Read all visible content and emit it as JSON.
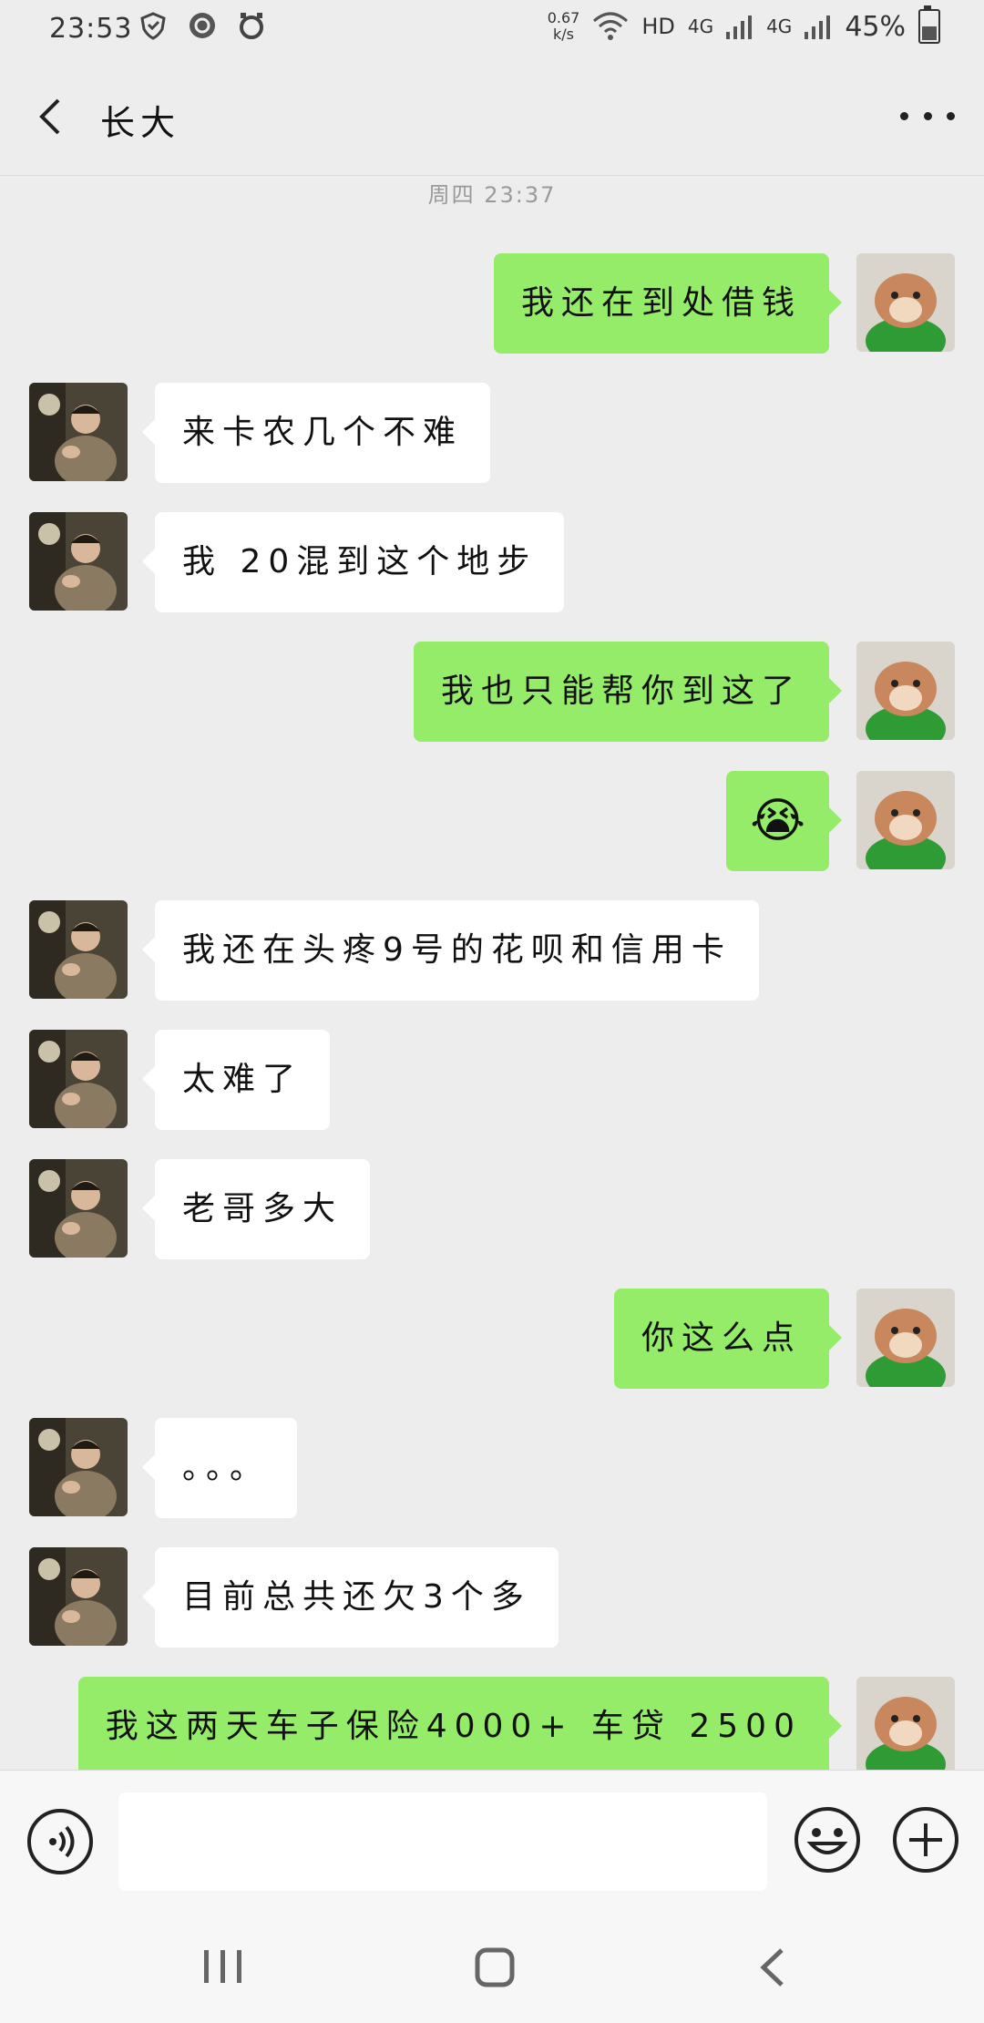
{
  "status_bar": {
    "time": "23:53",
    "speed_value": "0.67",
    "speed_unit": "k/s",
    "hd": "HD",
    "net1": "4G",
    "net2": "4G",
    "battery": "45%"
  },
  "header": {
    "title": "长大"
  },
  "chat": {
    "timestamp": "周四 23:37",
    "messages": [
      {
        "side": "out",
        "text": "我还在到处借钱"
      },
      {
        "side": "in",
        "text": "来卡农几个不难"
      },
      {
        "side": "in",
        "text": "我 20混到这个地步"
      },
      {
        "side": "out",
        "text": "我也只能帮你到这了"
      },
      {
        "side": "out",
        "text": "😭"
      },
      {
        "side": "in",
        "text": "我还在头疼9号的花呗和信用卡"
      },
      {
        "side": "in",
        "text": "太难了"
      },
      {
        "side": "in",
        "text": "老哥多大"
      },
      {
        "side": "out",
        "text": "你这么点"
      },
      {
        "side": "in",
        "text": "。。。"
      },
      {
        "side": "in",
        "text": "目前总共还欠3个多"
      },
      {
        "side": "out",
        "text": "我这两天车子保险4000+ 车贷 2500"
      }
    ]
  },
  "input": {
    "placeholder": ""
  },
  "icons": {
    "back": "back-arrow-icon",
    "more": "more-dots-icon",
    "voice": "voice-icon",
    "emoji": "emoji-icon",
    "plus": "plus-icon",
    "nav_recents": "recents-icon",
    "nav_home": "home-icon",
    "nav_back": "nav-back-icon"
  },
  "colors": {
    "outgoing_bubble": "#95ec69",
    "incoming_bubble": "#ffffff",
    "background": "#ededed"
  }
}
